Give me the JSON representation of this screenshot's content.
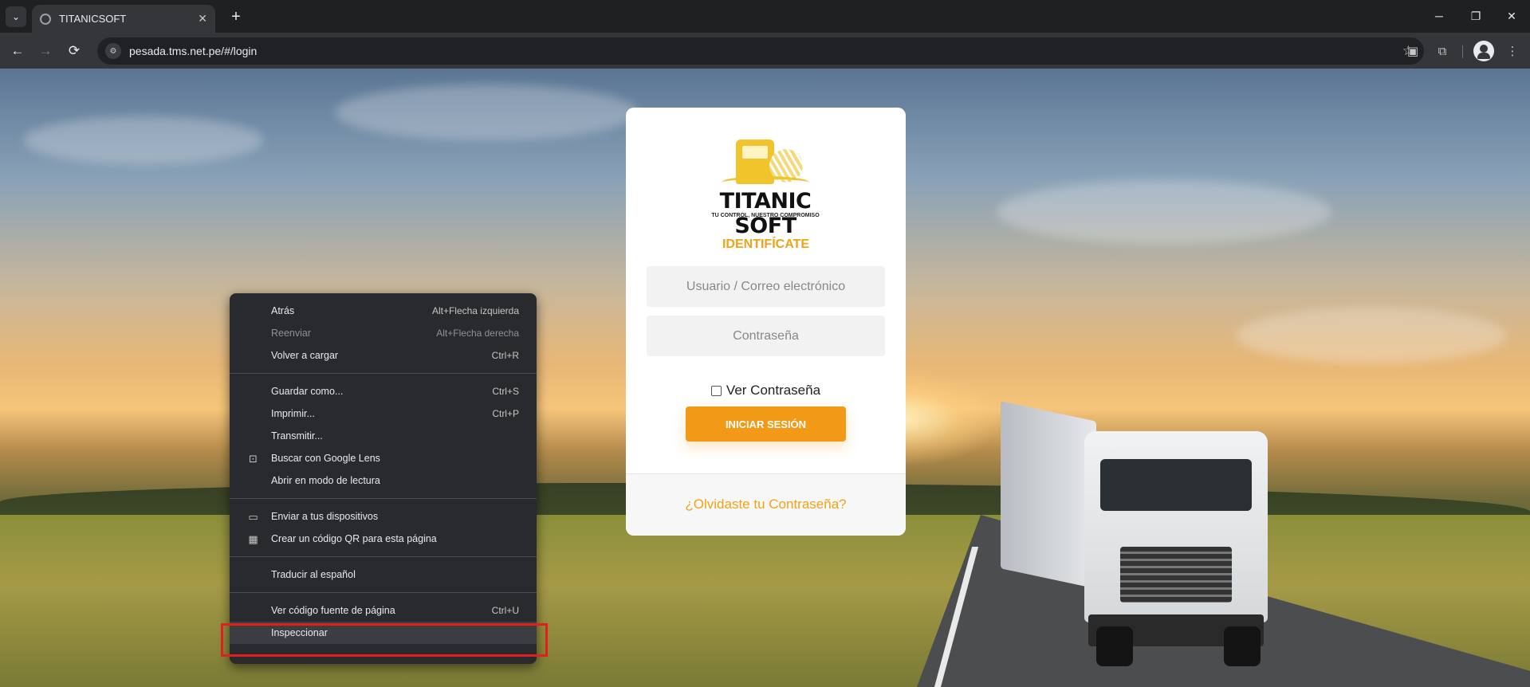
{
  "browser": {
    "tab_title": "TITANICSOFT",
    "url": "pesada.tms.net.pe/#/login",
    "icons": {
      "tab_menu": "chevron-down-icon",
      "new_tab": "+",
      "back": "←",
      "forward": "→",
      "reload": "⟳",
      "bookmark": "☆",
      "minimize": "─",
      "restore": "❐",
      "close": "✕",
      "more": "⋮",
      "extension": "extensions-icon",
      "tab_close": "✕"
    }
  },
  "login": {
    "brand": "TITANIC SOFT",
    "tagline": "TU CONTROL, NUESTRO COMPROMISO",
    "heading": "IDENTIFÍCATE",
    "username_placeholder": "Usuario / Correo electrónico",
    "password_placeholder": "Contraseña",
    "show_password_label": "Ver Contraseña",
    "submit_label": "INICIAR SESIÓN",
    "forgot_label": "¿Olvidaste tu Contraseña?",
    "accent_color": "#f29a17"
  },
  "context_menu": {
    "items": [
      {
        "label": "Atrás",
        "accel": "Alt+Flecha izquierda",
        "disabled": false
      },
      {
        "label": "Reenviar",
        "accel": "Alt+Flecha derecha",
        "disabled": true
      },
      {
        "label": "Volver a cargar",
        "accel": "Ctrl+R",
        "disabled": false
      },
      {
        "label": "Guardar como...",
        "accel": "Ctrl+S",
        "disabled": false
      },
      {
        "label": "Imprimir...",
        "accel": "Ctrl+P",
        "disabled": false
      },
      {
        "label": "Transmitir...",
        "accel": "",
        "disabled": false
      },
      {
        "label": "Buscar con Google Lens",
        "accel": "",
        "icon": "google-lens-icon",
        "disabled": false
      },
      {
        "label": "Abrir en modo de lectura",
        "accel": "",
        "disabled": false
      },
      {
        "label": "Enviar a tus dispositivos",
        "accel": "",
        "icon": "devices-icon",
        "disabled": false
      },
      {
        "label": "Crear un código QR para esta página",
        "accel": "",
        "icon": "qr-code-icon",
        "disabled": false
      },
      {
        "label": "Traducir al español",
        "accel": "",
        "disabled": false
      },
      {
        "label": "Ver código fuente de página",
        "accel": "Ctrl+U",
        "disabled": false
      },
      {
        "label": "Inspeccionar",
        "accel": "",
        "disabled": false
      }
    ],
    "highlight_color": "#e0201b"
  }
}
